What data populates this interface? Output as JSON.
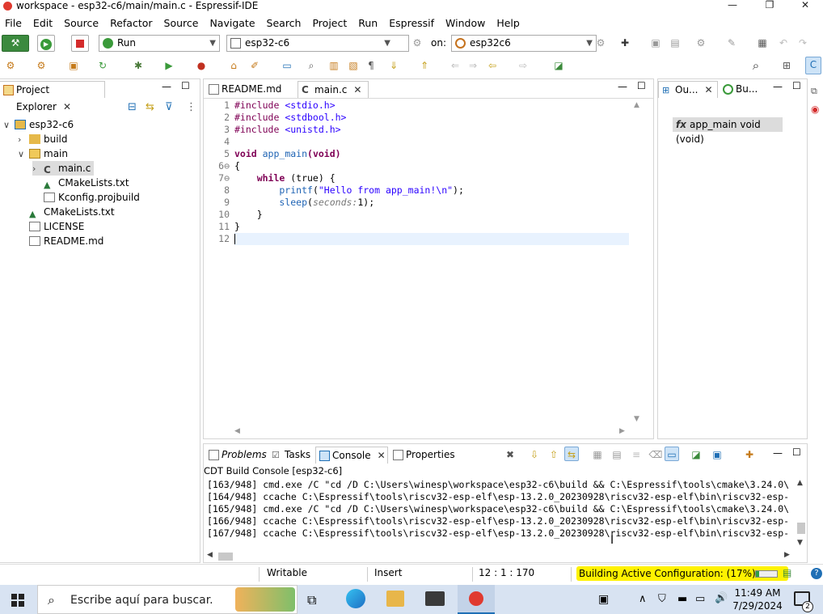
{
  "window": {
    "title": "workspace - esp32-c6/main/main.c - Espressif-IDE",
    "min_glyph": "—",
    "max_glyph": "❐",
    "close_glyph": "✕"
  },
  "menu": [
    "File",
    "Edit",
    "Source",
    "Refactor",
    "Source",
    "Navigate",
    "Search",
    "Project",
    "Run",
    "Espressif",
    "Window",
    "Help"
  ],
  "launchbar": {
    "mode": "Run",
    "config": "esp32-c6",
    "on_label": "on:",
    "target": "esp32c6"
  },
  "project_explorer": {
    "title": "Project Explorer",
    "tree": [
      {
        "label": "esp32-c6",
        "depth": 0,
        "icon": "project-icon",
        "expander": "∨"
      },
      {
        "label": "build",
        "depth": 1,
        "icon": "folder-icon",
        "expander": "›"
      },
      {
        "label": "main",
        "depth": 1,
        "icon": "folder-open-icon",
        "expander": "∨"
      },
      {
        "label": "main.c",
        "depth": 2,
        "icon": "c-file-icon",
        "expander": "›",
        "selected": true
      },
      {
        "label": "CMakeLists.txt",
        "depth": 2,
        "icon": "cmake-icon",
        "expander": ""
      },
      {
        "label": "Kconfig.projbuild",
        "depth": 2,
        "icon": "file-icon",
        "expander": ""
      },
      {
        "label": "CMakeLists.txt",
        "depth": 1,
        "icon": "cmake-icon",
        "expander": ""
      },
      {
        "label": "LICENSE",
        "depth": 1,
        "icon": "binary-file-icon",
        "expander": ""
      },
      {
        "label": "README.md",
        "depth": 1,
        "icon": "file-icon",
        "expander": ""
      }
    ]
  },
  "editor": {
    "tabs": [
      {
        "label": "README.md",
        "active": false
      },
      {
        "label": "main.c",
        "active": true
      }
    ],
    "line_numbers": [
      "1",
      "2",
      "3",
      "4",
      "5",
      "6⊖",
      "7⊖",
      "8",
      "9",
      "10",
      "11",
      "12"
    ],
    "code": {
      "l1a": "#include",
      "l1b": " <stdio.h>",
      "l2a": "#include",
      "l2b": " <stdbool.h>",
      "l3a": "#include",
      "l3b": " <unistd.h>",
      "l5a": "void",
      "l5b": " app_main",
      "l5c": "(void)",
      "l6": "{",
      "l7a": "    while",
      "l7b": " (true) {",
      "l8a": "        printf",
      "l8b": "(",
      "l8c": "\"Hello from app_main!\\n\"",
      "l8d": ");",
      "l9a": "        sleep",
      "l9b": "(",
      "l9c": "seconds:",
      "l9d": "1);",
      "l10": "    }",
      "l11": "}"
    }
  },
  "outline": {
    "tab1": "Ou...",
    "tab2": "Bu...",
    "item_prefix": "fx",
    "item": "app_main void (void)"
  },
  "bottom": {
    "tabs": [
      "Problems",
      "Tasks",
      "Console",
      "Properties"
    ],
    "active": "Console",
    "console_title": "CDT Build Console [esp32-c6]",
    "lines": [
      "[163/948] cmd.exe /C \"cd /D C:\\Users\\winesp\\workspace\\esp32-c6\\build && C:\\Espressif\\tools\\cmake\\3.24.0\\",
      "[164/948] ccache C:\\Espressif\\tools\\riscv32-esp-elf\\esp-13.2.0_20230928\\riscv32-esp-elf\\bin\\riscv32-esp-",
      "[165/948] cmd.exe /C \"cd /D C:\\Users\\winesp\\workspace\\esp32-c6\\build && C:\\Espressif\\tools\\cmake\\3.24.0\\",
      "[166/948] ccache C:\\Espressif\\tools\\riscv32-esp-elf\\esp-13.2.0_20230928\\riscv32-esp-elf\\bin\\riscv32-esp-",
      "[167/948] ccache C:\\Espressif\\tools\\riscv32-esp-elf\\esp-13.2.0_20230928\\riscv32-esp-elf\\bin\\riscv32-esp-"
    ]
  },
  "status": {
    "writable": "Writable",
    "insert": "Insert",
    "position": "12 : 1 : 170",
    "build": "Building Active Configuration: (17%)",
    "progress": 0.17,
    "highlight_color": "#fff200"
  },
  "taskbar": {
    "search_placeholder": "Escribe aquí para buscar.",
    "time": "11:49 AM",
    "date": "7/29/2024",
    "notifications": "2"
  },
  "colors": {
    "accent_blue": "#1f6fb5",
    "taskbar": "#d8e3f2",
    "selection": "#cce4f7",
    "line_highlight": "#e8f2fe"
  }
}
